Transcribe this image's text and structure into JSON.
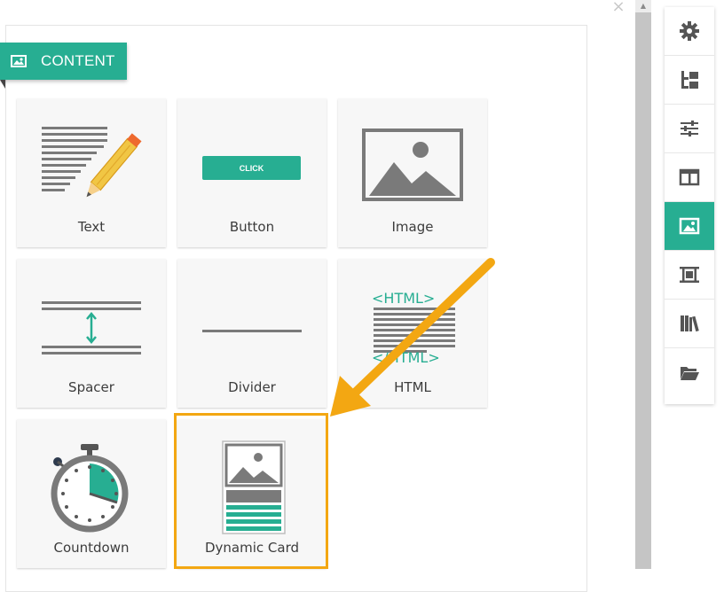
{
  "panel": {
    "tab_label": "CONTENT",
    "close_glyph": "×"
  },
  "tiles": [
    {
      "label": "Text",
      "icon": "text-icon"
    },
    {
      "label": "Button",
      "icon": "button-icon",
      "button_text": "CLICK"
    },
    {
      "label": "Image",
      "icon": "image-icon"
    },
    {
      "label": "Spacer",
      "icon": "spacer-icon"
    },
    {
      "label": "Divider",
      "icon": "divider-icon"
    },
    {
      "label": "HTML",
      "icon": "html-icon",
      "code_open": "<HTML>",
      "code_close": "</HTML>"
    },
    {
      "label": "Countdown",
      "icon": "countdown-icon"
    },
    {
      "label": "Dynamic Card",
      "icon": "dynamic-card-icon"
    }
  ],
  "sidebar": {
    "items": [
      {
        "icon": "gear-icon"
      },
      {
        "icon": "structure-icon"
      },
      {
        "icon": "sliders-icon"
      },
      {
        "icon": "columns-icon"
      },
      {
        "icon": "image-icon",
        "active": true
      },
      {
        "icon": "section-icon"
      },
      {
        "icon": "library-icon"
      },
      {
        "icon": "folder-icon"
      }
    ]
  },
  "colors": {
    "accent": "#27ae92",
    "highlight": "#f3a712",
    "icon_gray": "#7a7a7a"
  }
}
